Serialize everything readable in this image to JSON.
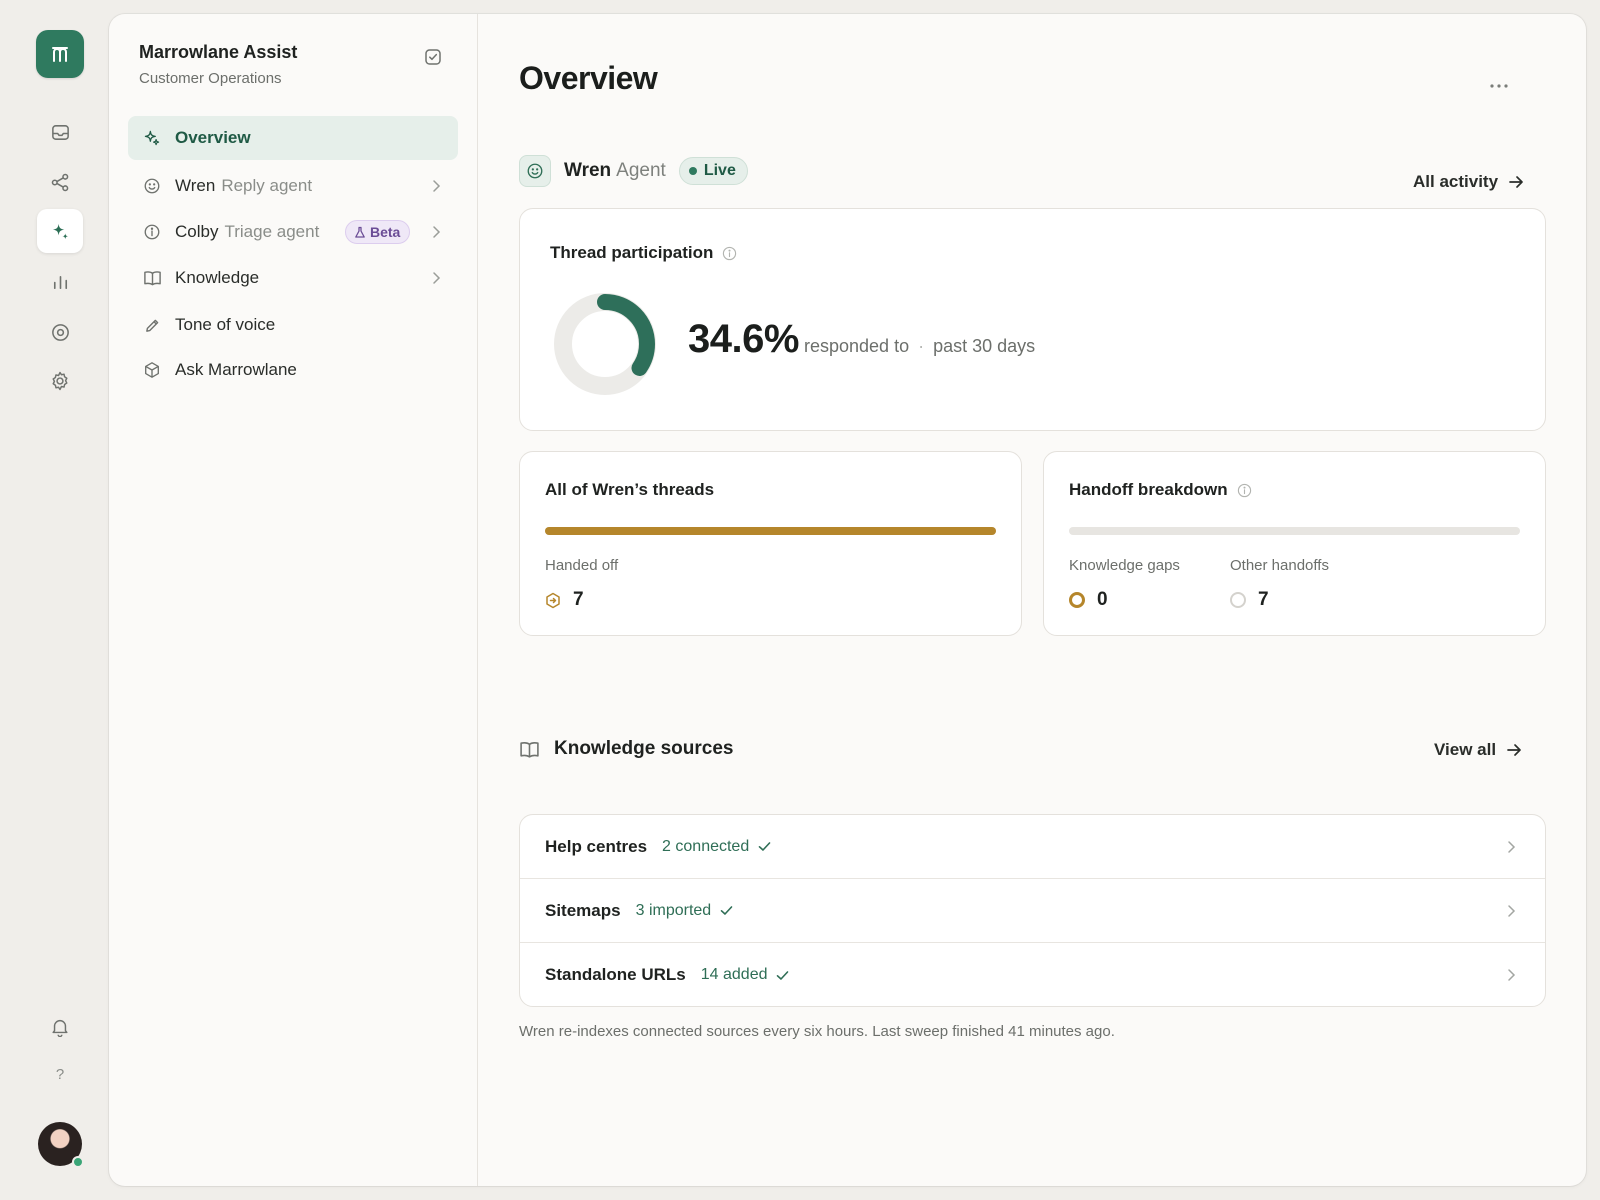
{
  "colors": {
    "brand": "#2f7a5f",
    "brand_tint": "#e6efea",
    "accent_gold": "#b5862b",
    "beta_purple": "#6b4d96",
    "background": "#f0eeea",
    "panel": "#fbfaf8"
  },
  "rail": {
    "logo_icon": "marrowlane-logo",
    "items": [
      {
        "icon": "inbox-icon"
      },
      {
        "icon": "share-icon"
      },
      {
        "icon": "sparkle-icon",
        "active": true
      },
      {
        "icon": "bar-chart-icon"
      },
      {
        "icon": "target-icon"
      },
      {
        "icon": "gear-icon"
      }
    ],
    "bell_icon": "bell-icon",
    "help_label": "?",
    "avatar": "user-avatar",
    "presence": "online"
  },
  "workspace": {
    "title": "Marrowlane Assist",
    "subtitle": "Customer Operations",
    "action_icon": "check-square-icon"
  },
  "nav": [
    {
      "label": "Overview",
      "icon": "sparkle-icon",
      "active": true
    },
    {
      "label": "Wren",
      "muted": "Reply agent",
      "icon": "smile-icon",
      "chevron": true
    },
    {
      "label": "Colby",
      "muted": "Triage agent",
      "icon": "info-icon",
      "badge": "Beta",
      "badge_icon": "flask-icon",
      "chevron": true
    },
    {
      "label": "Knowledge",
      "icon": "book-icon",
      "chevron": true
    },
    {
      "label": "Tone of voice",
      "icon": "pencil-icon"
    },
    {
      "label": "Ask Marrowlane",
      "icon": "cube-icon"
    }
  ],
  "main": {
    "title": "Overview",
    "more_icon": "ellipsis-icon",
    "agent": {
      "name": "Wren",
      "type": "Agent",
      "status": "Live",
      "icon": "smile-icon"
    },
    "all_activity_label": "All activity",
    "participation": {
      "title": "Thread participation",
      "value": "34.6%",
      "fraction": 0.346,
      "caption": "responded to",
      "period": "past 30 days"
    },
    "threads": {
      "title": "All of Wren’s threads",
      "bar_fraction": 1.0,
      "stat_label": "Handed off",
      "stat_value": "7",
      "stat_icon": "hexagon-handoff-icon"
    },
    "handoff": {
      "title": "Handoff breakdown",
      "bar_fraction": 0.0,
      "stats": [
        {
          "label": "Knowledge gaps",
          "value": "0"
        },
        {
          "label": "Other handoffs",
          "value": "7"
        }
      ]
    },
    "knowledge": {
      "title": "Knowledge sources",
      "view_all_label": "View all",
      "sources": [
        {
          "name": "Help centres",
          "status": "2 connected"
        },
        {
          "name": "Sitemaps",
          "status": "3 imported"
        },
        {
          "name": "Standalone URLs",
          "status": "14 added"
        }
      ],
      "footnote": "Wren re-indexes connected sources every six hours. Last sweep finished 41 minutes ago."
    }
  }
}
